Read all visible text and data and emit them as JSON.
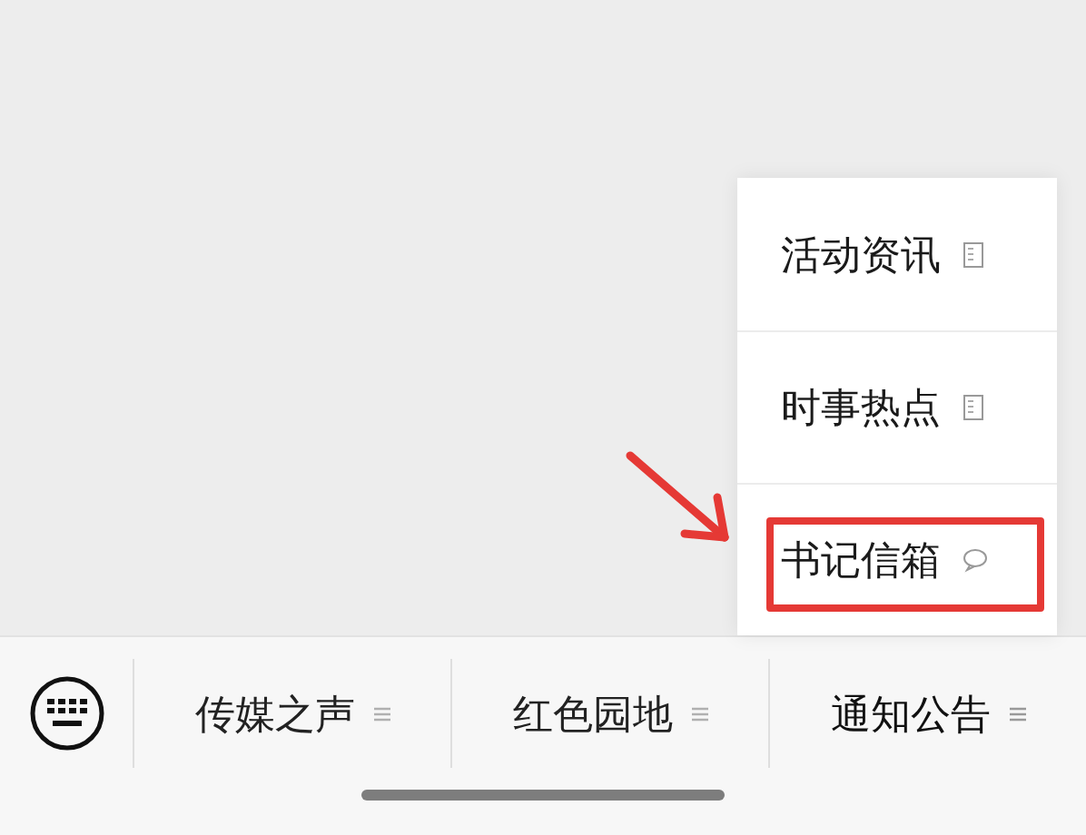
{
  "menu_bar": {
    "items": [
      {
        "label": "传媒之声",
        "selected": false
      },
      {
        "label": "红色园地",
        "selected": false
      },
      {
        "label": "通知公告",
        "selected": true
      }
    ]
  },
  "submenu": {
    "items": [
      {
        "label": "活动资讯",
        "kind": "article",
        "highlighted": false
      },
      {
        "label": "时事热点",
        "kind": "article",
        "highlighted": false
      },
      {
        "label": "书记信箱",
        "kind": "message",
        "highlighted": true
      }
    ]
  }
}
